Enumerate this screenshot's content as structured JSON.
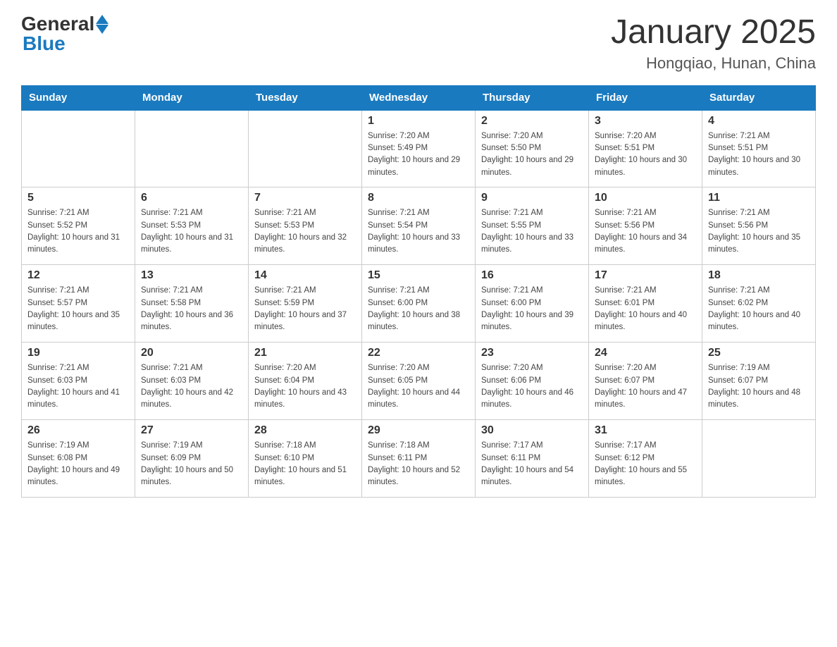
{
  "logo": {
    "general": "General",
    "blue": "Blue",
    "triangle": "▲"
  },
  "title": "January 2025",
  "subtitle": "Hongqiao, Hunan, China",
  "days_of_week": [
    "Sunday",
    "Monday",
    "Tuesday",
    "Wednesday",
    "Thursday",
    "Friday",
    "Saturday"
  ],
  "weeks": [
    [
      {
        "day": "",
        "info": ""
      },
      {
        "day": "",
        "info": ""
      },
      {
        "day": "",
        "info": ""
      },
      {
        "day": "1",
        "info": "Sunrise: 7:20 AM\nSunset: 5:49 PM\nDaylight: 10 hours and 29 minutes."
      },
      {
        "day": "2",
        "info": "Sunrise: 7:20 AM\nSunset: 5:50 PM\nDaylight: 10 hours and 29 minutes."
      },
      {
        "day": "3",
        "info": "Sunrise: 7:20 AM\nSunset: 5:51 PM\nDaylight: 10 hours and 30 minutes."
      },
      {
        "day": "4",
        "info": "Sunrise: 7:21 AM\nSunset: 5:51 PM\nDaylight: 10 hours and 30 minutes."
      }
    ],
    [
      {
        "day": "5",
        "info": "Sunrise: 7:21 AM\nSunset: 5:52 PM\nDaylight: 10 hours and 31 minutes."
      },
      {
        "day": "6",
        "info": "Sunrise: 7:21 AM\nSunset: 5:53 PM\nDaylight: 10 hours and 31 minutes."
      },
      {
        "day": "7",
        "info": "Sunrise: 7:21 AM\nSunset: 5:53 PM\nDaylight: 10 hours and 32 minutes."
      },
      {
        "day": "8",
        "info": "Sunrise: 7:21 AM\nSunset: 5:54 PM\nDaylight: 10 hours and 33 minutes."
      },
      {
        "day": "9",
        "info": "Sunrise: 7:21 AM\nSunset: 5:55 PM\nDaylight: 10 hours and 33 minutes."
      },
      {
        "day": "10",
        "info": "Sunrise: 7:21 AM\nSunset: 5:56 PM\nDaylight: 10 hours and 34 minutes."
      },
      {
        "day": "11",
        "info": "Sunrise: 7:21 AM\nSunset: 5:56 PM\nDaylight: 10 hours and 35 minutes."
      }
    ],
    [
      {
        "day": "12",
        "info": "Sunrise: 7:21 AM\nSunset: 5:57 PM\nDaylight: 10 hours and 35 minutes."
      },
      {
        "day": "13",
        "info": "Sunrise: 7:21 AM\nSunset: 5:58 PM\nDaylight: 10 hours and 36 minutes."
      },
      {
        "day": "14",
        "info": "Sunrise: 7:21 AM\nSunset: 5:59 PM\nDaylight: 10 hours and 37 minutes."
      },
      {
        "day": "15",
        "info": "Sunrise: 7:21 AM\nSunset: 6:00 PM\nDaylight: 10 hours and 38 minutes."
      },
      {
        "day": "16",
        "info": "Sunrise: 7:21 AM\nSunset: 6:00 PM\nDaylight: 10 hours and 39 minutes."
      },
      {
        "day": "17",
        "info": "Sunrise: 7:21 AM\nSunset: 6:01 PM\nDaylight: 10 hours and 40 minutes."
      },
      {
        "day": "18",
        "info": "Sunrise: 7:21 AM\nSunset: 6:02 PM\nDaylight: 10 hours and 40 minutes."
      }
    ],
    [
      {
        "day": "19",
        "info": "Sunrise: 7:21 AM\nSunset: 6:03 PM\nDaylight: 10 hours and 41 minutes."
      },
      {
        "day": "20",
        "info": "Sunrise: 7:21 AM\nSunset: 6:03 PM\nDaylight: 10 hours and 42 minutes."
      },
      {
        "day": "21",
        "info": "Sunrise: 7:20 AM\nSunset: 6:04 PM\nDaylight: 10 hours and 43 minutes."
      },
      {
        "day": "22",
        "info": "Sunrise: 7:20 AM\nSunset: 6:05 PM\nDaylight: 10 hours and 44 minutes."
      },
      {
        "day": "23",
        "info": "Sunrise: 7:20 AM\nSunset: 6:06 PM\nDaylight: 10 hours and 46 minutes."
      },
      {
        "day": "24",
        "info": "Sunrise: 7:20 AM\nSunset: 6:07 PM\nDaylight: 10 hours and 47 minutes."
      },
      {
        "day": "25",
        "info": "Sunrise: 7:19 AM\nSunset: 6:07 PM\nDaylight: 10 hours and 48 minutes."
      }
    ],
    [
      {
        "day": "26",
        "info": "Sunrise: 7:19 AM\nSunset: 6:08 PM\nDaylight: 10 hours and 49 minutes."
      },
      {
        "day": "27",
        "info": "Sunrise: 7:19 AM\nSunset: 6:09 PM\nDaylight: 10 hours and 50 minutes."
      },
      {
        "day": "28",
        "info": "Sunrise: 7:18 AM\nSunset: 6:10 PM\nDaylight: 10 hours and 51 minutes."
      },
      {
        "day": "29",
        "info": "Sunrise: 7:18 AM\nSunset: 6:11 PM\nDaylight: 10 hours and 52 minutes."
      },
      {
        "day": "30",
        "info": "Sunrise: 7:17 AM\nSunset: 6:11 PM\nDaylight: 10 hours and 54 minutes."
      },
      {
        "day": "31",
        "info": "Sunrise: 7:17 AM\nSunset: 6:12 PM\nDaylight: 10 hours and 55 minutes."
      },
      {
        "day": "",
        "info": ""
      }
    ]
  ]
}
